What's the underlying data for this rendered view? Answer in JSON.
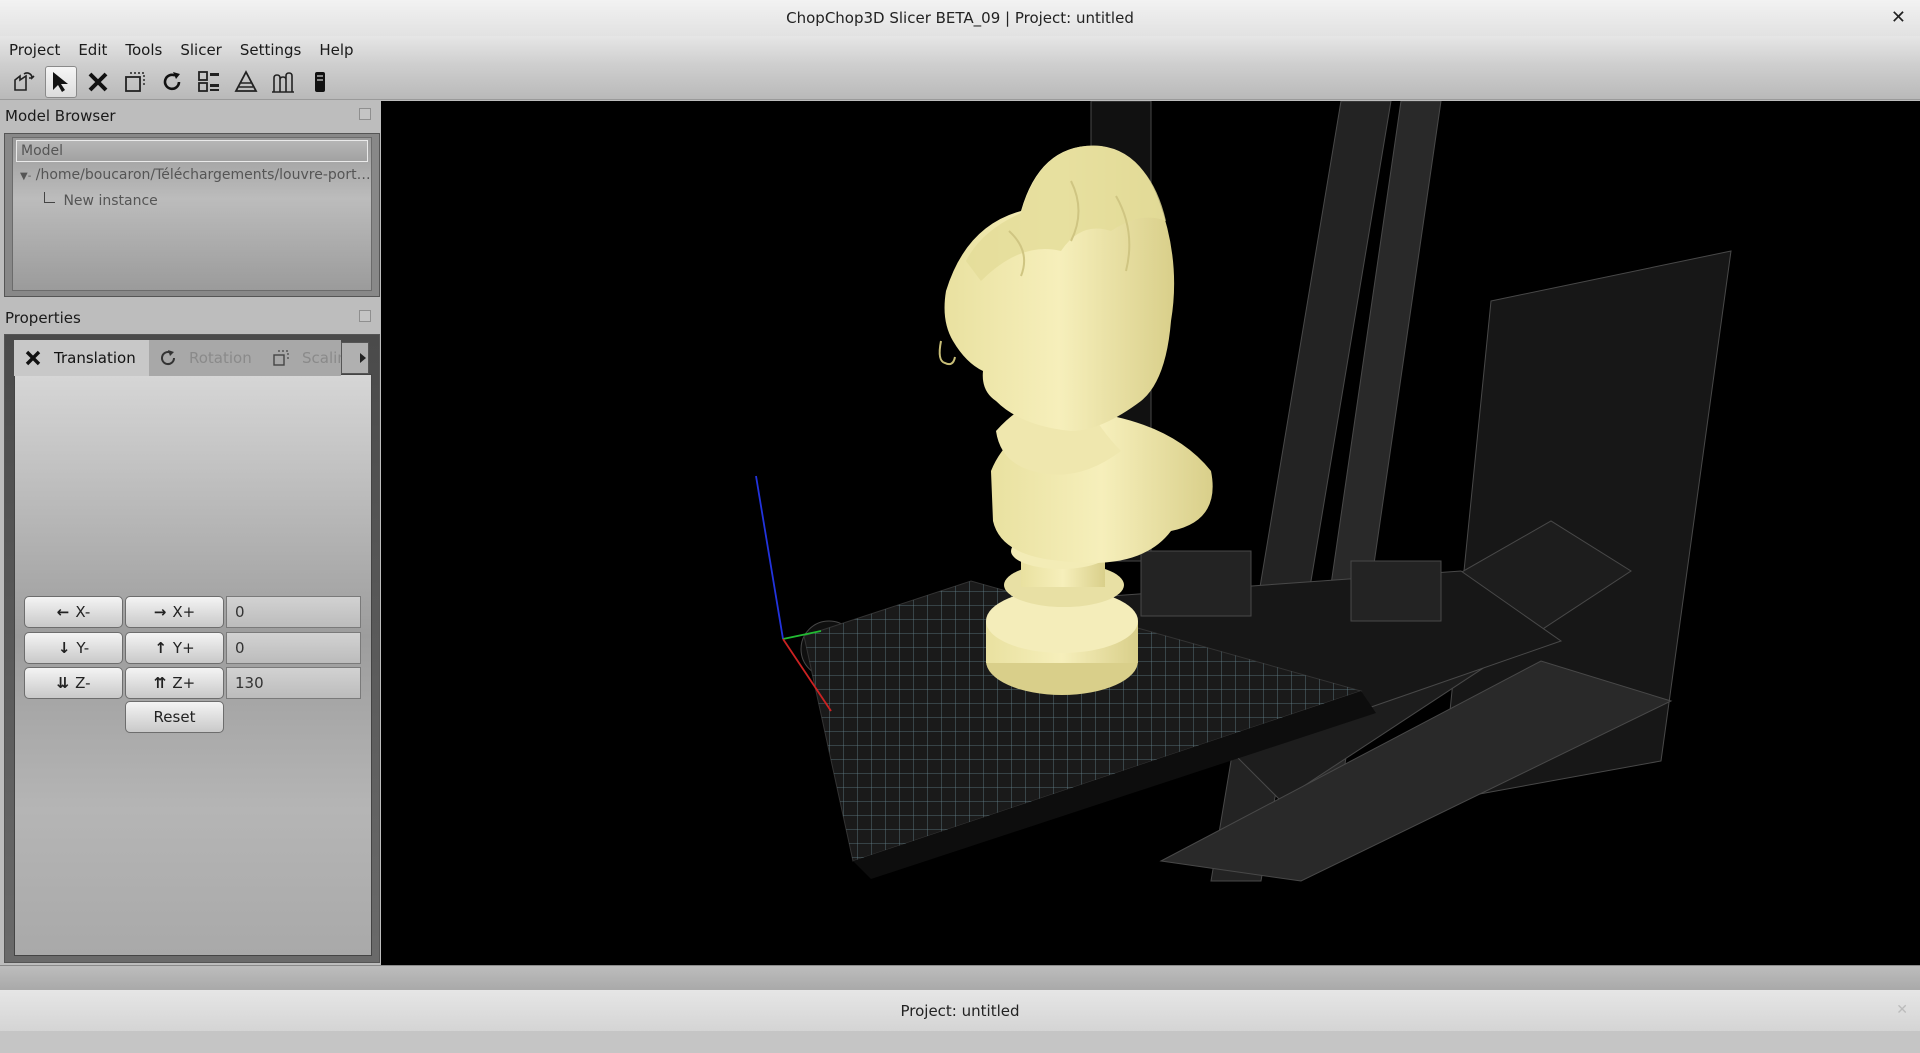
{
  "window": {
    "title": "ChopChop3D Slicer BETA_09 | Project: untitled",
    "close_icon": "close-icon"
  },
  "menu": [
    "Project",
    "Edit",
    "Tools",
    "Slicer",
    "Settings",
    "Help"
  ],
  "toolbar": {
    "buttons": [
      "open-project-icon",
      "select-pointer-icon",
      "translate-icon",
      "scale-icon",
      "rotate-icon",
      "arrange-icon",
      "slice-icon",
      "supports-icon",
      "printer-icon"
    ],
    "active": "select-pointer-icon"
  },
  "model_browser": {
    "title": "Model Browser",
    "column_header": "Model",
    "file_path": "/home/boucaron/Téléchargements/louvre-port…",
    "instance_label": "New instance"
  },
  "properties": {
    "title": "Properties",
    "tabs": [
      {
        "label": "Translation",
        "icon": "translate-icon",
        "active": true
      },
      {
        "label": "Rotation",
        "icon": "rotate-icon",
        "active": false
      },
      {
        "label": "Scalin",
        "icon": "scale-icon",
        "active": false
      }
    ],
    "translation": {
      "x_minus": "X-",
      "x_plus": "X+",
      "x_value": "0",
      "y_minus": "Y-",
      "y_plus": "Y+",
      "y_value": "0",
      "z_minus": "Z-",
      "z_plus": "Z+",
      "z_value": "130",
      "reset": "Reset"
    }
  },
  "status": {
    "text": "Project: untitled"
  },
  "colors": {
    "model": "#f3ecae",
    "viewport_bg": "#000000",
    "bed_grid": "#6d8f9a"
  }
}
